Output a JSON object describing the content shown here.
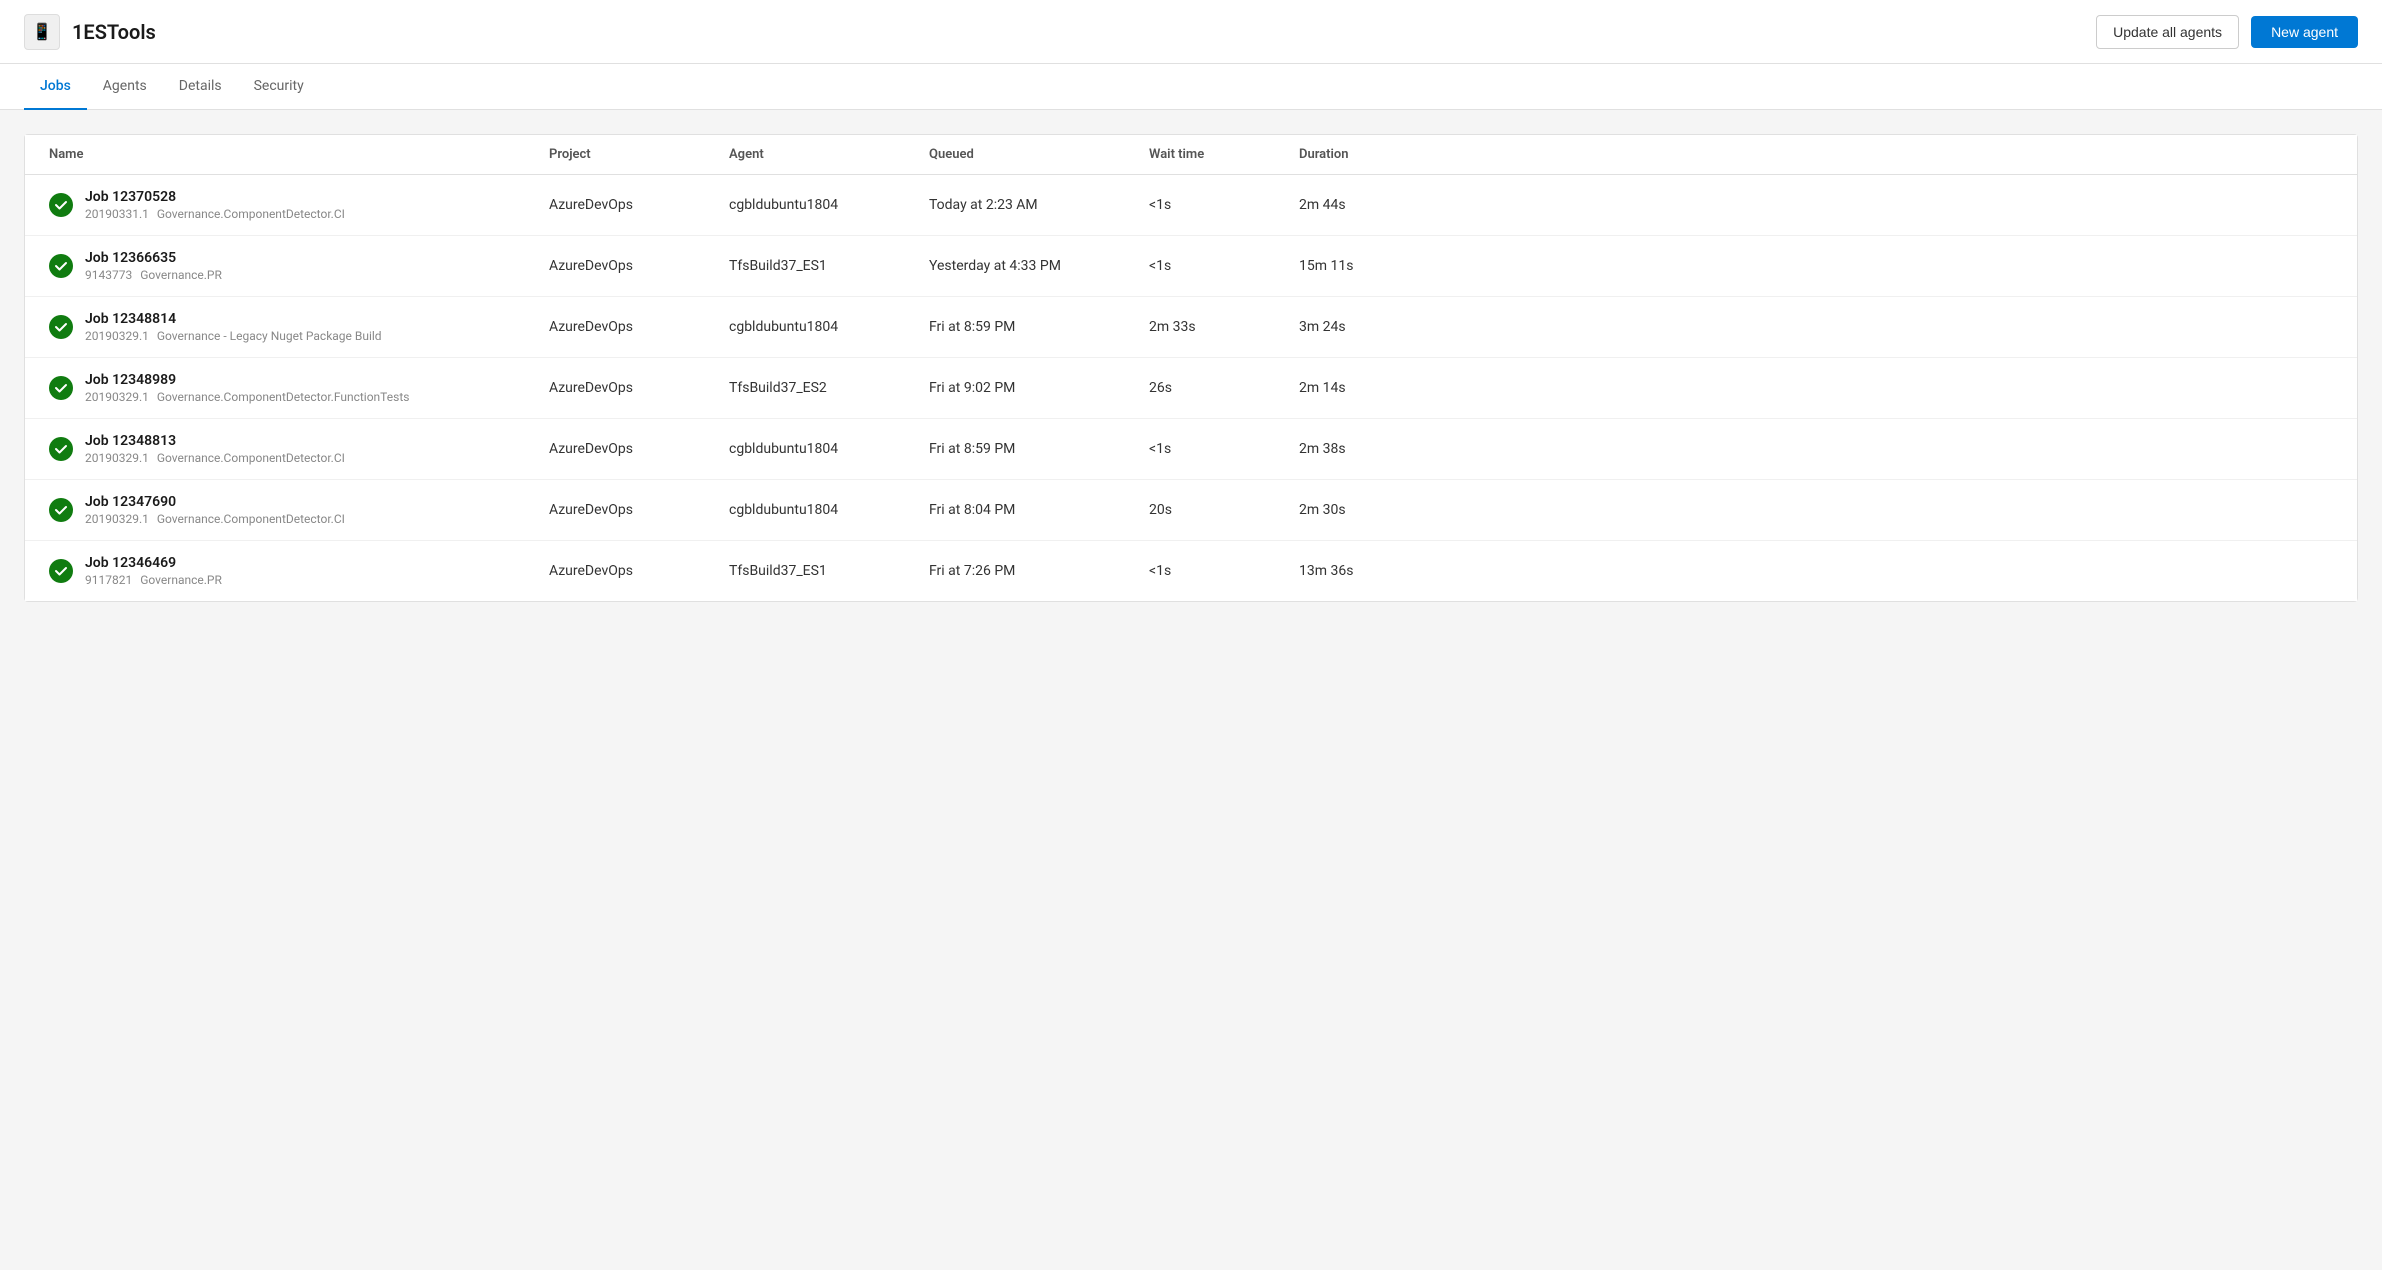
{
  "header": {
    "app_icon": "📱",
    "app_title": "1ESTools",
    "update_all_agents_label": "Update all agents",
    "new_agent_label": "New agent"
  },
  "nav": {
    "tabs": [
      {
        "id": "jobs",
        "label": "Jobs",
        "active": true
      },
      {
        "id": "agents",
        "label": "Agents",
        "active": false
      },
      {
        "id": "details",
        "label": "Details",
        "active": false
      },
      {
        "id": "security",
        "label": "Security",
        "active": false
      }
    ]
  },
  "table": {
    "columns": [
      {
        "id": "name",
        "label": "Name"
      },
      {
        "id": "project",
        "label": "Project"
      },
      {
        "id": "agent",
        "label": "Agent"
      },
      {
        "id": "queued",
        "label": "Queued"
      },
      {
        "id": "wait_time",
        "label": "Wait time"
      },
      {
        "id": "duration",
        "label": "Duration"
      }
    ],
    "rows": [
      {
        "status": "success",
        "job_name": "Job 12370528",
        "job_id": "20190331.1",
        "job_pipeline": "Governance.ComponentDetector.CI",
        "project": "AzureDevOps",
        "agent": "cgbldubuntu1804",
        "queued": "Today at 2:23 AM",
        "wait_time": "<1s",
        "duration": "2m 44s"
      },
      {
        "status": "success",
        "job_name": "Job 12366635",
        "job_id": "9143773",
        "job_pipeline": "Governance.PR",
        "project": "AzureDevOps",
        "agent": "TfsBuild37_ES1",
        "queued": "Yesterday at 4:33 PM",
        "wait_time": "<1s",
        "duration": "15m 11s"
      },
      {
        "status": "success",
        "job_name": "Job 12348814",
        "job_id": "20190329.1",
        "job_pipeline": "Governance - Legacy Nuget Package Build",
        "project": "AzureDevOps",
        "agent": "cgbldubuntu1804",
        "queued": "Fri at 8:59 PM",
        "wait_time": "2m 33s",
        "duration": "3m 24s"
      },
      {
        "status": "success",
        "job_name": "Job 12348989",
        "job_id": "20190329.1",
        "job_pipeline": "Governance.ComponentDetector.FunctionTests",
        "project": "AzureDevOps",
        "agent": "TfsBuild37_ES2",
        "queued": "Fri at 9:02 PM",
        "wait_time": "26s",
        "duration": "2m 14s"
      },
      {
        "status": "success",
        "job_name": "Job 12348813",
        "job_id": "20190329.1",
        "job_pipeline": "Governance.ComponentDetector.CI",
        "project": "AzureDevOps",
        "agent": "cgbldubuntu1804",
        "queued": "Fri at 8:59 PM",
        "wait_time": "<1s",
        "duration": "2m 38s"
      },
      {
        "status": "success",
        "job_name": "Job 12347690",
        "job_id": "20190329.1",
        "job_pipeline": "Governance.ComponentDetector.CI",
        "project": "AzureDevOps",
        "agent": "cgbldubuntu1804",
        "queued": "Fri at 8:04 PM",
        "wait_time": "20s",
        "duration": "2m 30s"
      },
      {
        "status": "success",
        "job_name": "Job 12346469",
        "job_id": "9117821",
        "job_pipeline": "Governance.PR",
        "project": "AzureDevOps",
        "agent": "TfsBuild37_ES1",
        "queued": "Fri at 7:26 PM",
        "wait_time": "<1s",
        "duration": "13m 36s"
      }
    ]
  }
}
